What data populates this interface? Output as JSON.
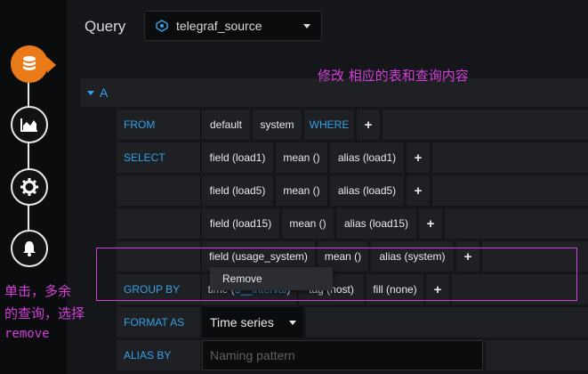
{
  "header": {
    "title": "Query",
    "datasource": "telegraf_source"
  },
  "query_row": {
    "letter": "A"
  },
  "annotation": {
    "top": "修改 相应的表和查询内容",
    "left_line1": "单击，多余",
    "left_line2": "的查询，选择",
    "left_line3": "remove",
    "color": "#d43fd9"
  },
  "rail": {
    "icons": [
      "database-icon",
      "chart-area-icon",
      "gear-icon",
      "bell-icon"
    ],
    "accent": "#eb7b18"
  },
  "editor": {
    "from": {
      "label": "FROM",
      "policy": "default",
      "measurement": "system",
      "where": "WHERE",
      "add": "+"
    },
    "select": {
      "label": "SELECT",
      "rows": [
        {
          "field": "field (load1)",
          "fn": "mean ()",
          "alias": "alias (load1)",
          "add": "+"
        },
        {
          "field": "field (load5)",
          "fn": "mean ()",
          "alias": "alias (load5)",
          "add": "+"
        },
        {
          "field": "field (load15)",
          "fn": "mean ()",
          "alias": "alias (load15)",
          "add": "+"
        },
        {
          "field": "field (usage_system)",
          "fn": "mean ()",
          "alias": "alias (system)",
          "add": "+"
        }
      ]
    },
    "group_by": {
      "label": "GROUP BY",
      "time_prefix": "time (",
      "time_interval": "$__interval",
      "time_suffix": ")",
      "tag": "tag (host)",
      "fill": "fill (none)",
      "add": "+"
    },
    "format_as": {
      "label": "FORMAT AS",
      "value": "Time series"
    },
    "alias_by": {
      "label": "ALIAS BY",
      "placeholder": "Naming pattern"
    },
    "context_menu": {
      "item": "Remove"
    }
  },
  "colors": {
    "keyword": "#33a2e5",
    "panel": "#1f2024",
    "background": "#141619"
  }
}
